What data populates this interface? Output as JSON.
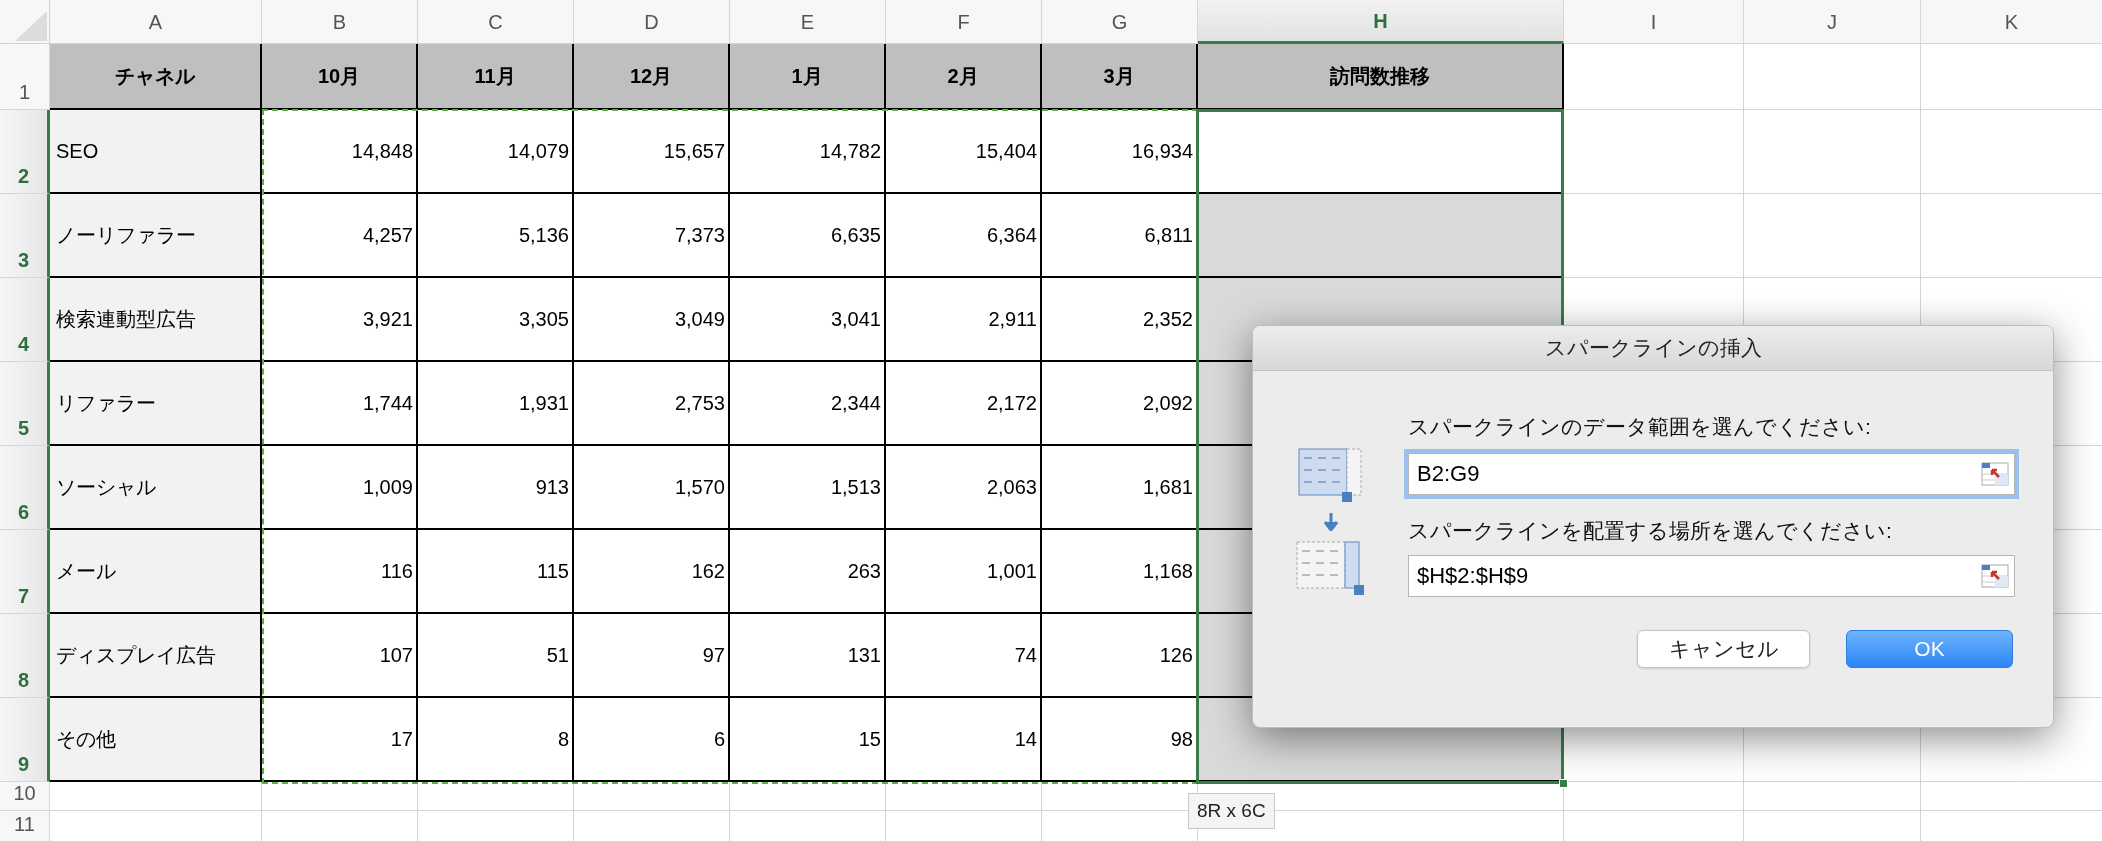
{
  "column_headers": [
    {
      "label": "A",
      "selected": false
    },
    {
      "label": "B",
      "selected": false
    },
    {
      "label": "C",
      "selected": false
    },
    {
      "label": "D",
      "selected": false
    },
    {
      "label": "E",
      "selected": false
    },
    {
      "label": "F",
      "selected": false
    },
    {
      "label": "G",
      "selected": false
    },
    {
      "label": "H",
      "selected": true
    },
    {
      "label": "I",
      "selected": false
    },
    {
      "label": "J",
      "selected": false
    },
    {
      "label": "K",
      "selected": false
    }
  ],
  "row_headers": [
    {
      "label": "1",
      "selected": false
    },
    {
      "label": "2",
      "selected": true
    },
    {
      "label": "3",
      "selected": true
    },
    {
      "label": "4",
      "selected": true
    },
    {
      "label": "5",
      "selected": true
    },
    {
      "label": "6",
      "selected": true
    },
    {
      "label": "7",
      "selected": true
    },
    {
      "label": "8",
      "selected": true
    },
    {
      "label": "9",
      "selected": true
    },
    {
      "label": "10",
      "selected": false
    },
    {
      "label": "11",
      "selected": false
    }
  ],
  "table": {
    "columns": [
      "チャネル",
      "10月",
      "11月",
      "12月",
      "1月",
      "2月",
      "3月",
      "訪問数推移"
    ],
    "rows": [
      {
        "channel": "SEO",
        "values": [
          "14,848",
          "14,079",
          "15,657",
          "14,782",
          "15,404",
          "16,934"
        ],
        "trend_active": true
      },
      {
        "channel": "ノーリファラー",
        "values": [
          "4,257",
          "5,136",
          "7,373",
          "6,635",
          "6,364",
          "6,811"
        ],
        "trend_active": false
      },
      {
        "channel": "検索連動型広告",
        "values": [
          "3,921",
          "3,305",
          "3,049",
          "3,041",
          "2,911",
          "2,352"
        ],
        "trend_active": false
      },
      {
        "channel": "リファラー",
        "values": [
          "1,744",
          "1,931",
          "2,753",
          "2,344",
          "2,172",
          "2,092"
        ],
        "trend_active": false
      },
      {
        "channel": "ソーシャル",
        "values": [
          "1,009",
          "913",
          "1,570",
          "1,513",
          "2,063",
          "1,681"
        ],
        "trend_active": false
      },
      {
        "channel": "メール",
        "values": [
          "116",
          "115",
          "162",
          "263",
          "1,001",
          "1,168"
        ],
        "trend_active": false
      },
      {
        "channel": "ディスプレイ広告",
        "values": [
          "107",
          "51",
          "97",
          "131",
          "74",
          "126"
        ],
        "trend_active": false
      },
      {
        "channel": "その他",
        "values": [
          "17",
          "8",
          "6",
          "15",
          "14",
          "98"
        ],
        "trend_active": false
      }
    ]
  },
  "selection_size": "8R x 6C",
  "dialog": {
    "title": "スパークラインの挿入",
    "data_range_label": "スパークラインのデータ範囲を選んでください:",
    "data_range": {
      "value": "B2:G9",
      "focused": true
    },
    "location_label": "スパークラインを配置する場所を選んでください:",
    "location": {
      "value": "$H$2:$H$9",
      "focused": false
    },
    "buttons": [
      "キャンセル",
      "OK"
    ]
  }
}
